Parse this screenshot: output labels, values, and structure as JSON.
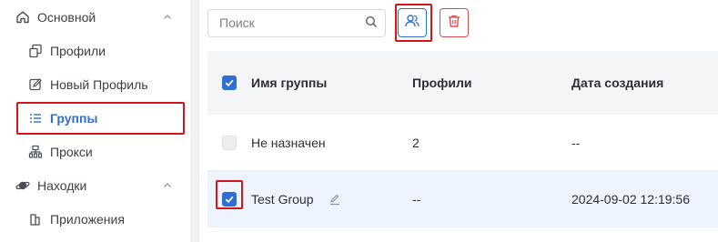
{
  "sidebar": {
    "sections": [
      {
        "label": "Основной",
        "icon": "home-icon",
        "expanded": true,
        "items": [
          {
            "label": "Профили",
            "icon": "profiles-icon",
            "active": false
          },
          {
            "label": "Новый Профиль",
            "icon": "edit-square-icon",
            "active": false
          },
          {
            "label": "Группы",
            "icon": "list-icon",
            "active": true
          },
          {
            "label": "Прокси",
            "icon": "network-icon",
            "active": false
          }
        ]
      },
      {
        "label": "Находки",
        "icon": "planet-icon",
        "expanded": true,
        "items": [
          {
            "label": "Приложения",
            "icon": "apps-icon",
            "active": false
          }
        ]
      }
    ]
  },
  "toolbar": {
    "search_placeholder": "Поиск",
    "group_button_icon": "users-icon",
    "delete_button_icon": "trash-icon"
  },
  "table": {
    "columns": [
      "Имя группы",
      "Профили",
      "Дата создания"
    ],
    "header_checked": true,
    "rows": [
      {
        "name": "Не назначен",
        "profiles": "2",
        "created": "--",
        "checked": false,
        "checkbox_disabled": true,
        "editable": false,
        "selected": false
      },
      {
        "name": "Test Group",
        "profiles": "--",
        "created": "2024-09-02 12:19:56",
        "checked": true,
        "checkbox_disabled": false,
        "editable": true,
        "selected": true
      }
    ]
  },
  "colors": {
    "accent": "#2f6fd1",
    "danger": "#e34c4c",
    "highlight": "#d4141a",
    "selected_row": "#eef4fd",
    "header_bg": "#f4f5f7"
  }
}
